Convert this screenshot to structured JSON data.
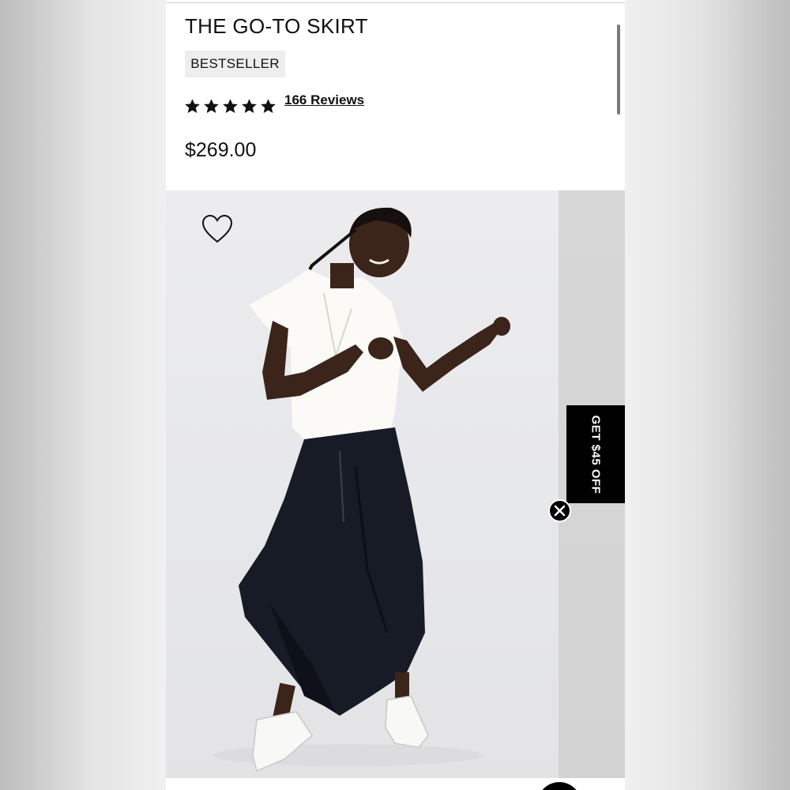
{
  "product": {
    "title": "THE GO-TO SKIRT",
    "badge": "BESTSELLER",
    "rating": 5,
    "rating_max": 5,
    "reviews_label": "166 Reviews",
    "price": "$269.00"
  },
  "icons": {
    "star": "star-icon",
    "wishlist": "heart-outline-icon",
    "close": "close-icon"
  },
  "promo": {
    "tab_label": "GET $45 OFF"
  },
  "colors": {
    "text": "#111111",
    "badge_bg": "#eeeeee",
    "promo_bg": "#000000",
    "photo_bg": "#e7e8eb"
  }
}
